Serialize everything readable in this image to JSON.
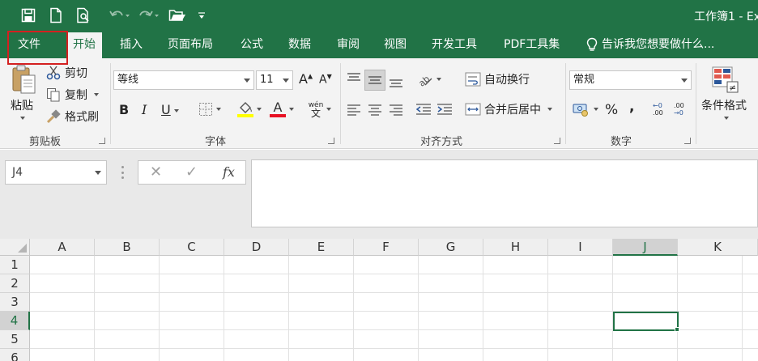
{
  "title": {
    "text": "工作簿1 - Ex"
  },
  "quick_access": {
    "icons": [
      "save-icon",
      "new-document-icon",
      "print-preview-icon",
      "undo-icon",
      "redo-icon",
      "open-folder-icon",
      "customize-qat-icon"
    ]
  },
  "tabs": [
    {
      "label": "文件"
    },
    {
      "label": "开始"
    },
    {
      "label": "插入"
    },
    {
      "label": "页面布局"
    },
    {
      "label": "公式"
    },
    {
      "label": "数据"
    },
    {
      "label": "审阅"
    },
    {
      "label": "视图"
    },
    {
      "label": "开发工具"
    },
    {
      "label": "PDF工具集"
    }
  ],
  "tell_me": {
    "text": "告诉我您想要做什么..."
  },
  "ribbon": {
    "clipboard": {
      "paste": "粘贴",
      "cut": "剪切",
      "copy": "复制",
      "format_painter": "格式刷",
      "label": "剪贴板"
    },
    "font": {
      "font_name": "等线",
      "font_size": "11",
      "bold": "B",
      "italic": "I",
      "underline": "U",
      "grow": "A",
      "shrink": "A",
      "phonetic": "wén",
      "label": "字体",
      "highlight_color": "#ffff00",
      "font_color": "#e81123"
    },
    "alignment": {
      "wrap_text": "自动换行",
      "merge_center": "合并后居中",
      "label": "对齐方式"
    },
    "number": {
      "format": "常规",
      "percent": "%",
      "comma": ",",
      "inc_decimal_top": "←0",
      "inc_decimal_bottom": ".00",
      "dec_decimal_top": ".00",
      "dec_decimal_bottom": "→0",
      "label": "数字"
    },
    "styles": {
      "conditional_format": "条件格式"
    }
  },
  "formula_bar": {
    "name_box": "J4",
    "cancel": "✕",
    "enter": "✓",
    "fx": "fx",
    "formula": ""
  },
  "sheet": {
    "columns": [
      "A",
      "B",
      "C",
      "D",
      "E",
      "F",
      "G",
      "H",
      "I",
      "J",
      "K"
    ],
    "rows": [
      "1",
      "2",
      "3",
      "4",
      "5",
      "6"
    ],
    "selected_column": "J",
    "selected_row": "4"
  },
  "colors": {
    "accent": "#217346",
    "highlight_box": "#d42020"
  }
}
